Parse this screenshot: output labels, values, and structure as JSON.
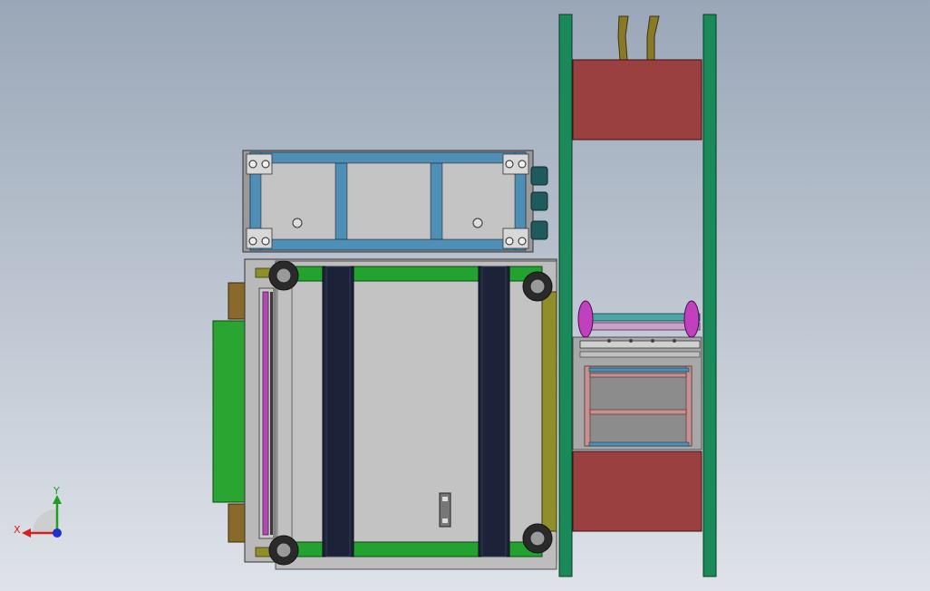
{
  "triad": {
    "x_label": "X",
    "y_label": "Y"
  },
  "colors": {
    "bg_top": "#9aa7b8",
    "bg_bottom": "#dfe3e9",
    "plate": "#bfbfbf",
    "frame_blue": "#4f8fb5",
    "frame_green": "#1ea035",
    "rail_green": "#1a8a5a",
    "belt_dark": "#1c2238",
    "block_red": "#9b4040",
    "olive": "#8f8e2a",
    "magenta": "#b04cb0",
    "axis_x": "#d42020",
    "axis_y": "#20a020",
    "axis_z": "#2030d0"
  }
}
